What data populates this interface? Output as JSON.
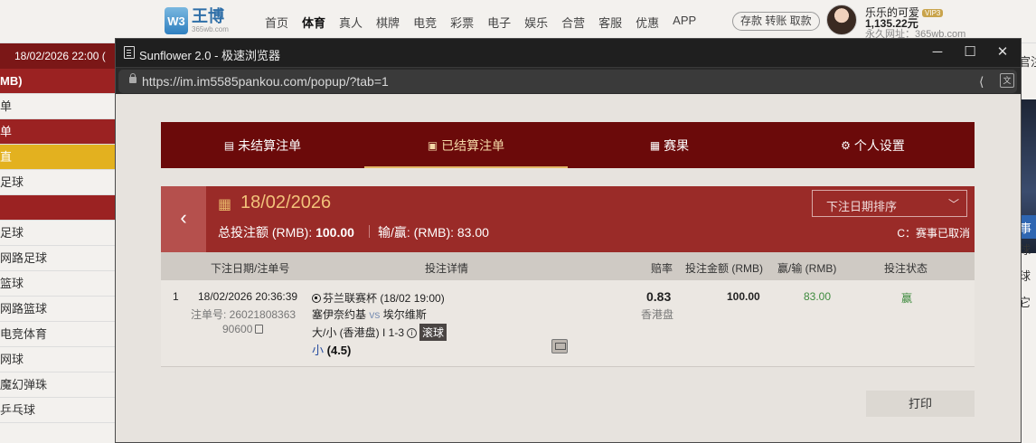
{
  "site": {
    "logo_mark": "W3",
    "logo_name": "王博",
    "logo_sub": "365wb.com",
    "nav": [
      "首页",
      "体育",
      "真人",
      "棋牌",
      "电竞",
      "彩票",
      "电子",
      "娱乐",
      "合营",
      "客服",
      "优惠",
      "APP"
    ],
    "nav_active": "体育",
    "deposit_pill": "存款 转账 取款",
    "user_name": "乐乐的可爱",
    "vip": "VIP3",
    "balance": "1,135.22元",
    "permanent_url": "永久网址：365wb.com"
  },
  "left_panel": {
    "date": "18/02/2026 22:00 (",
    "rows": [
      {
        "label": "MB)",
        "style": "red bold"
      },
      {
        "label": "单",
        "style": "light"
      },
      {
        "label": "单",
        "style": "red"
      },
      {
        "label": "直",
        "style": "yellow"
      },
      {
        "label": "足球",
        "style": "light"
      },
      {
        "label": "",
        "style": "red"
      },
      {
        "label": "足球",
        "style": "light"
      },
      {
        "label": "网路足球",
        "style": "light"
      },
      {
        "label": "篮球",
        "style": "light"
      },
      {
        "label": "网路篮球",
        "style": "light"
      },
      {
        "label": "电竞体育",
        "style": "light"
      },
      {
        "label": "网球",
        "style": "light"
      },
      {
        "label": "魔幻弹珠",
        "style": "light"
      },
      {
        "label": "乒乓球",
        "style": "light"
      }
    ]
  },
  "right_panel": {
    "top_text": "官注",
    "blue_text": "事",
    "items": [
      "球",
      "球",
      "它"
    ]
  },
  "window": {
    "title": "Sunflower 2.0 - 极速浏览器",
    "url": "https://im.im5585pankou.com/popup/?tab=1",
    "minimize": "─",
    "maximize": "☐",
    "close": "✕"
  },
  "tabs": [
    {
      "label": "未结算注单",
      "icon": "receipt-icon",
      "glyph": "▤",
      "active": false
    },
    {
      "label": "已结算注单",
      "icon": "settled-icon",
      "glyph": "▣",
      "active": true
    },
    {
      "label": "赛果",
      "icon": "scoreboard-icon",
      "glyph": "▦",
      "active": false
    },
    {
      "label": "个人设置",
      "icon": "gear-icon",
      "glyph": "⚙",
      "active": false
    }
  ],
  "summary": {
    "back": "‹",
    "date": "18/02/2026",
    "total_label": "总投注额 (RMB): ",
    "total_value": "100.00",
    "winloss_label": "输/赢: (RMB): ",
    "winloss_value": "83.00",
    "sort_placeholder": "下注日期排序",
    "legend": "C：赛事已取消"
  },
  "table": {
    "headers": [
      "下注日期/注单号",
      "投注详情",
      "赔率",
      "投注金额 (RMB)",
      "赢/输 (RMB)",
      "投注状态"
    ],
    "rows": [
      {
        "index": "1",
        "datetime": "18/02/2026 20:36:39",
        "bet_no_label": "注单号: 26021808363",
        "bet_no_cont": "90600",
        "league": "芬兰联赛杯 (18/02 19:00)",
        "home": "塞伊奈约基",
        "vs": "vs",
        "away": "埃尔维斯",
        "market": "大/小 (香港盘) I 1-3",
        "live": "滚球",
        "pick_label": "小",
        "pick_line": "(4.5)",
        "odds": "0.83",
        "odds_type": "香港盘",
        "stake": "100.00",
        "winloss": "83.00",
        "status": "赢"
      }
    ]
  },
  "print_label": "打印",
  "colors": {
    "tab_bar": "#6b0a0a",
    "summary_bar": "#9a2b28",
    "accent_gold": "#e4b869",
    "win_green": "#3e8b3e"
  }
}
